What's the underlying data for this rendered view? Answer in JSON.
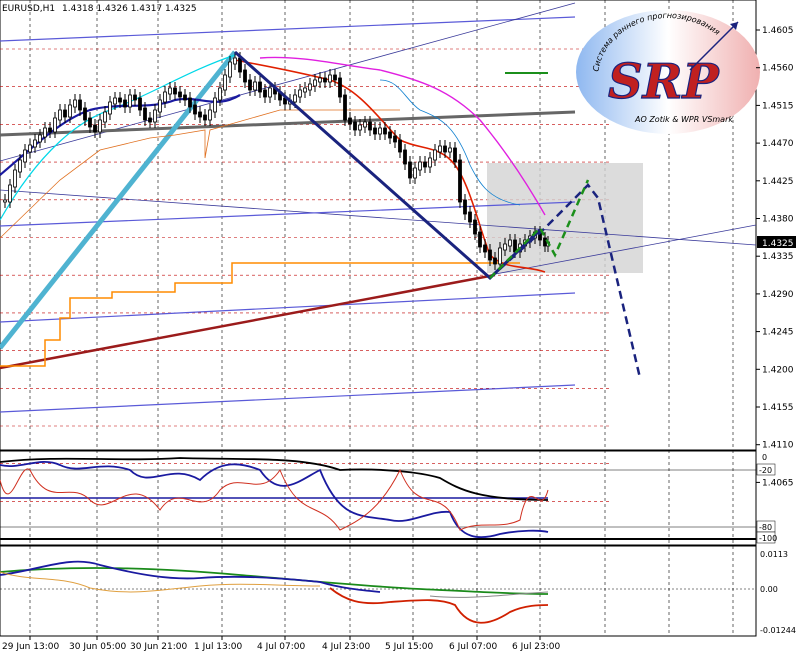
{
  "header": {
    "symbol": "EURUSD,H1",
    "quote": "1.4318 1.4326 1.4317 1.4325"
  },
  "logo": {
    "letters": "SRP",
    "arc_top": "Система раннего прогнозирования",
    "arc_bottom": "AO Zotik & WPR VSmark"
  },
  "price_axis": {
    "ticks": [
      "1.4605",
      "1.4560",
      "1.4515",
      "1.4470",
      "1.4425",
      "1.4380",
      "1.4335",
      "1.4290",
      "1.4245",
      "1.4200",
      "1.4155",
      "1.4110",
      "1.4065"
    ],
    "current_price": "1.4325"
  },
  "indicator1_axis": {
    "ticks": [
      "-20",
      "-80",
      "-100"
    ],
    "top_value": "0"
  },
  "indicator2_axis": {
    "ticks": [
      "0.0113",
      "0.00",
      "-0.01244"
    ]
  },
  "time_axis": {
    "labels": [
      "29 Jun 13:00",
      "30 Jun 05:00",
      "30 Jun 21:00",
      "1 Jul 13:00",
      "4 Jul 07:00",
      "4 Jul 23:00",
      "5 Jul 15:00",
      "6 Jul 07:00",
      "6 Jul 23:00"
    ]
  },
  "colors": {
    "background": "#ffffff",
    "grid_red": "#c00000",
    "forecast_navy": "#1a237e",
    "forecast_green": "#1b8f1b",
    "trend_cyan": "#4fb3d1",
    "support_darkred": "#9b1b1b",
    "ma_magenta": "#e020e0",
    "ma_red": "#e02000",
    "ma_orange": "#ff8c00",
    "ma_blue": "#1a1aa0",
    "ma_gray": "#666666"
  }
}
